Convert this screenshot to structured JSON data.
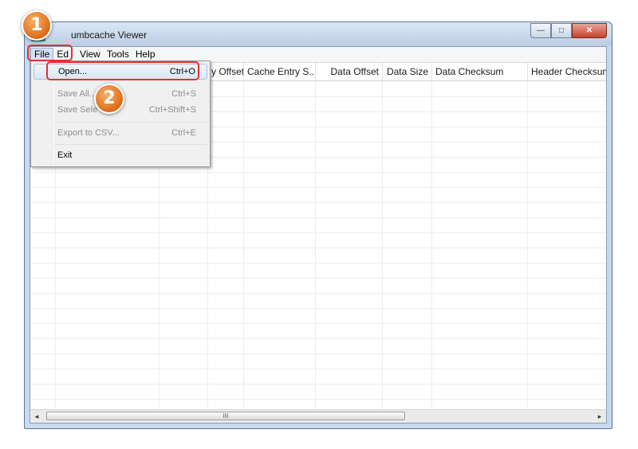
{
  "window": {
    "title": "umbcache Viewer",
    "buttons": {
      "minimize": "—",
      "maximize": "□",
      "close": "✕"
    }
  },
  "menubar": [
    "File",
    "Ed",
    "View",
    "Tools",
    "Help"
  ],
  "table": {
    "columns": [
      "",
      "",
      "",
      "y Offset",
      "Cache Entry S...",
      "Data Offset",
      "Data Size",
      "Data Checksum",
      "Header Checksum"
    ]
  },
  "scrollbar": {
    "thumb_grip": "III",
    "left_arrow": "◂",
    "right_arrow": "▸"
  },
  "file_menu": {
    "items": [
      {
        "label": "Open...",
        "shortcut": "Ctrl+O",
        "enabled": true
      },
      {
        "label": "Save All...",
        "shortcut": "Ctrl+S",
        "enabled": false
      },
      {
        "label": "Save Sele",
        "shortcut": "Ctrl+Shift+S",
        "enabled": false
      },
      {
        "label": "Export to CSV...",
        "shortcut": "Ctrl+E",
        "enabled": false
      },
      {
        "label": "Exit",
        "shortcut": "",
        "enabled": true
      }
    ]
  },
  "callouts": [
    "1",
    "2"
  ],
  "colors": {
    "callout": "#e0701c",
    "highlight": "#e53030",
    "menu_hover": "#dae6f5"
  }
}
